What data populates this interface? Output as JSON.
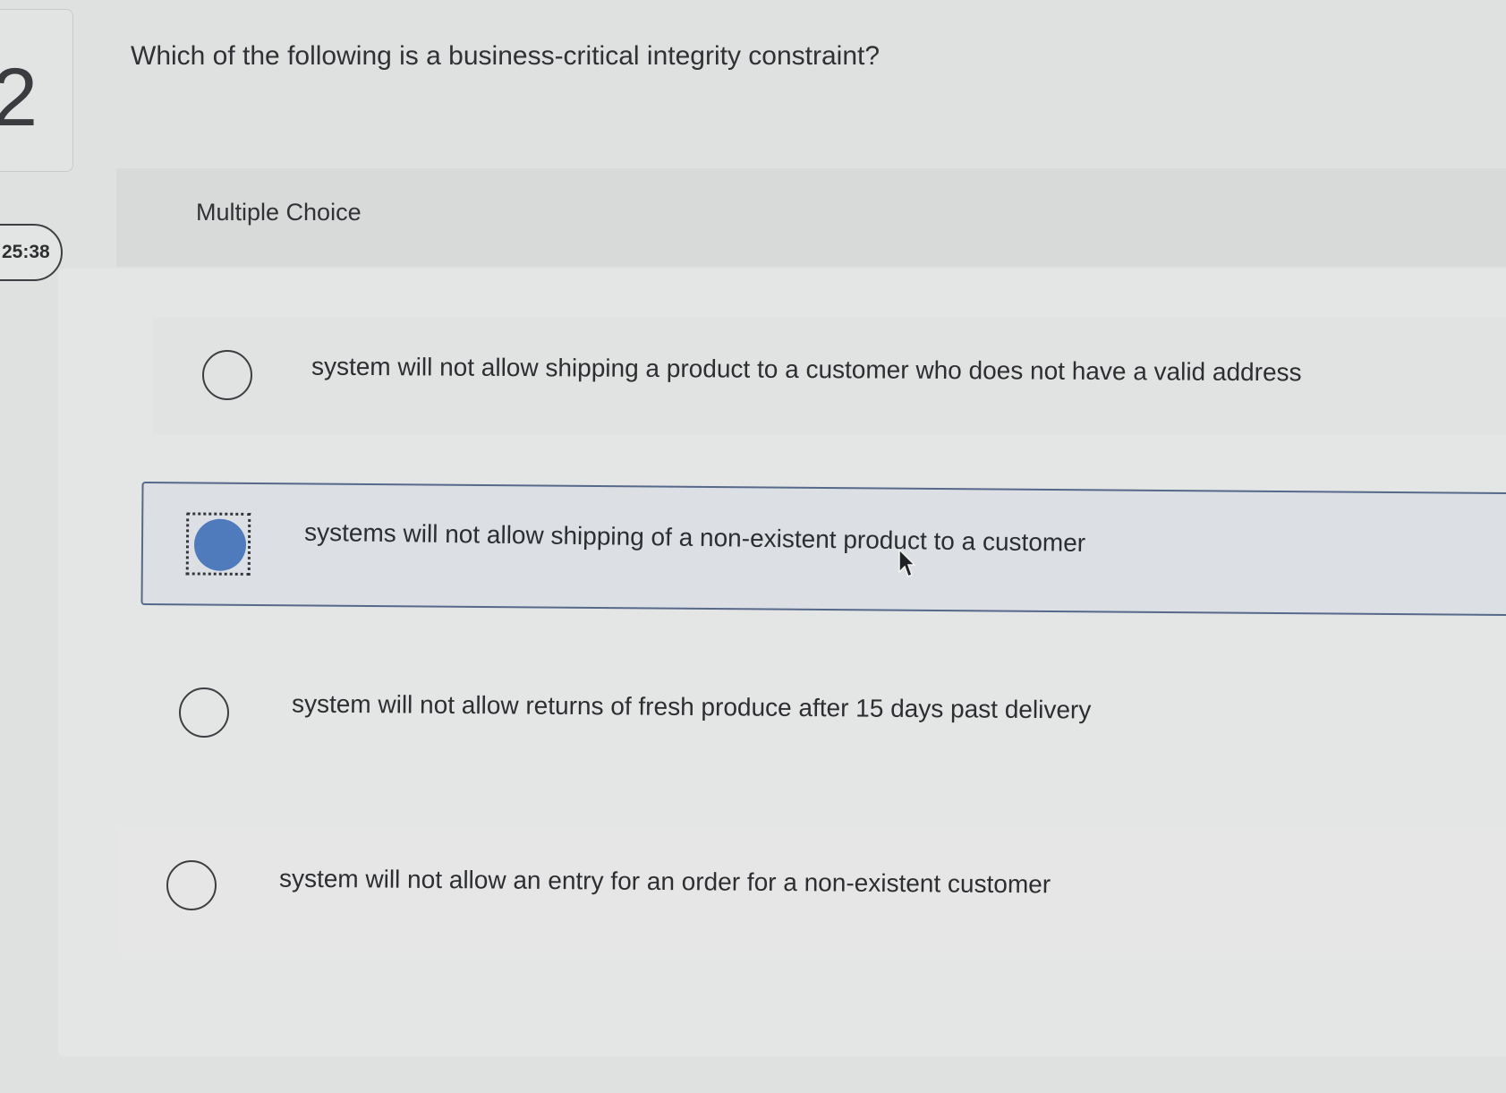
{
  "question": {
    "number": "2",
    "text": "Which of the following is a business-critical integrity constraint?"
  },
  "timer": {
    "value": "25:38"
  },
  "choice_type": "Multiple Choice",
  "options": [
    {
      "label": "system will not allow shipping a product to a customer who does not have a valid address",
      "selected": false
    },
    {
      "label": "systems will not allow shipping of a non-existent product to a customer",
      "selected": true
    },
    {
      "label": "system will not allow returns of fresh produce after 15 days past delivery",
      "selected": false
    },
    {
      "label": "system will not allow an entry for an order for a non-existent customer",
      "selected": false
    }
  ],
  "colors": {
    "selected_radio": "#4f7bbd",
    "selected_border": "#56698a",
    "page_background": "#dfe0e0"
  },
  "icons": {
    "cursor": "mouse-pointer-icon"
  }
}
